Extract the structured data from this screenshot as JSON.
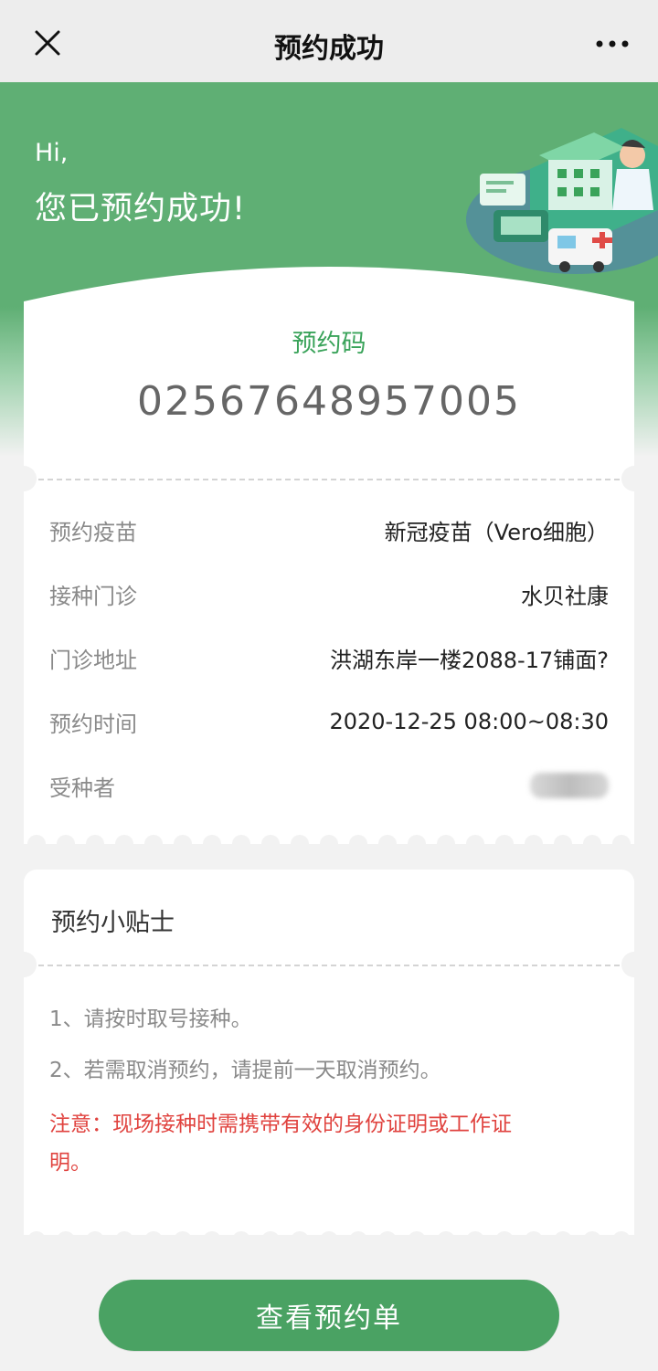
{
  "nav": {
    "title": "预约成功",
    "close_icon": "close-icon",
    "more_icon": "more-icon"
  },
  "hero": {
    "greeting": "Hi,",
    "message": "您已预约成功!"
  },
  "booking": {
    "code_label": "预约码",
    "code_value": "02567648957005",
    "rows": [
      {
        "label": "预约疫苗",
        "value": "新冠疫苗（Vero细胞）"
      },
      {
        "label": "接种门诊",
        "value": "水贝社康"
      },
      {
        "label": "门诊地址",
        "value": "洪湖东岸一楼2088-17铺面?"
      },
      {
        "label": "预约时间",
        "value": "2020-12-25 08:00~08:30"
      },
      {
        "label": "受种者",
        "value": ""
      }
    ]
  },
  "tips": {
    "title": "预约小贴士",
    "items": [
      "1、请按时取号接种。",
      "2、若需取消预约，请提前一天取消预约。"
    ],
    "warning_line1": "注意：现场接种时需携带有效的身份证明或工作证",
    "warning_line2": "明。"
  },
  "action": {
    "view_button": "查看预约单"
  },
  "colors": {
    "brand_green": "#5faf74",
    "button_green": "#4aa263",
    "code_green": "#3aa35a",
    "warning_red": "#e0433f"
  }
}
